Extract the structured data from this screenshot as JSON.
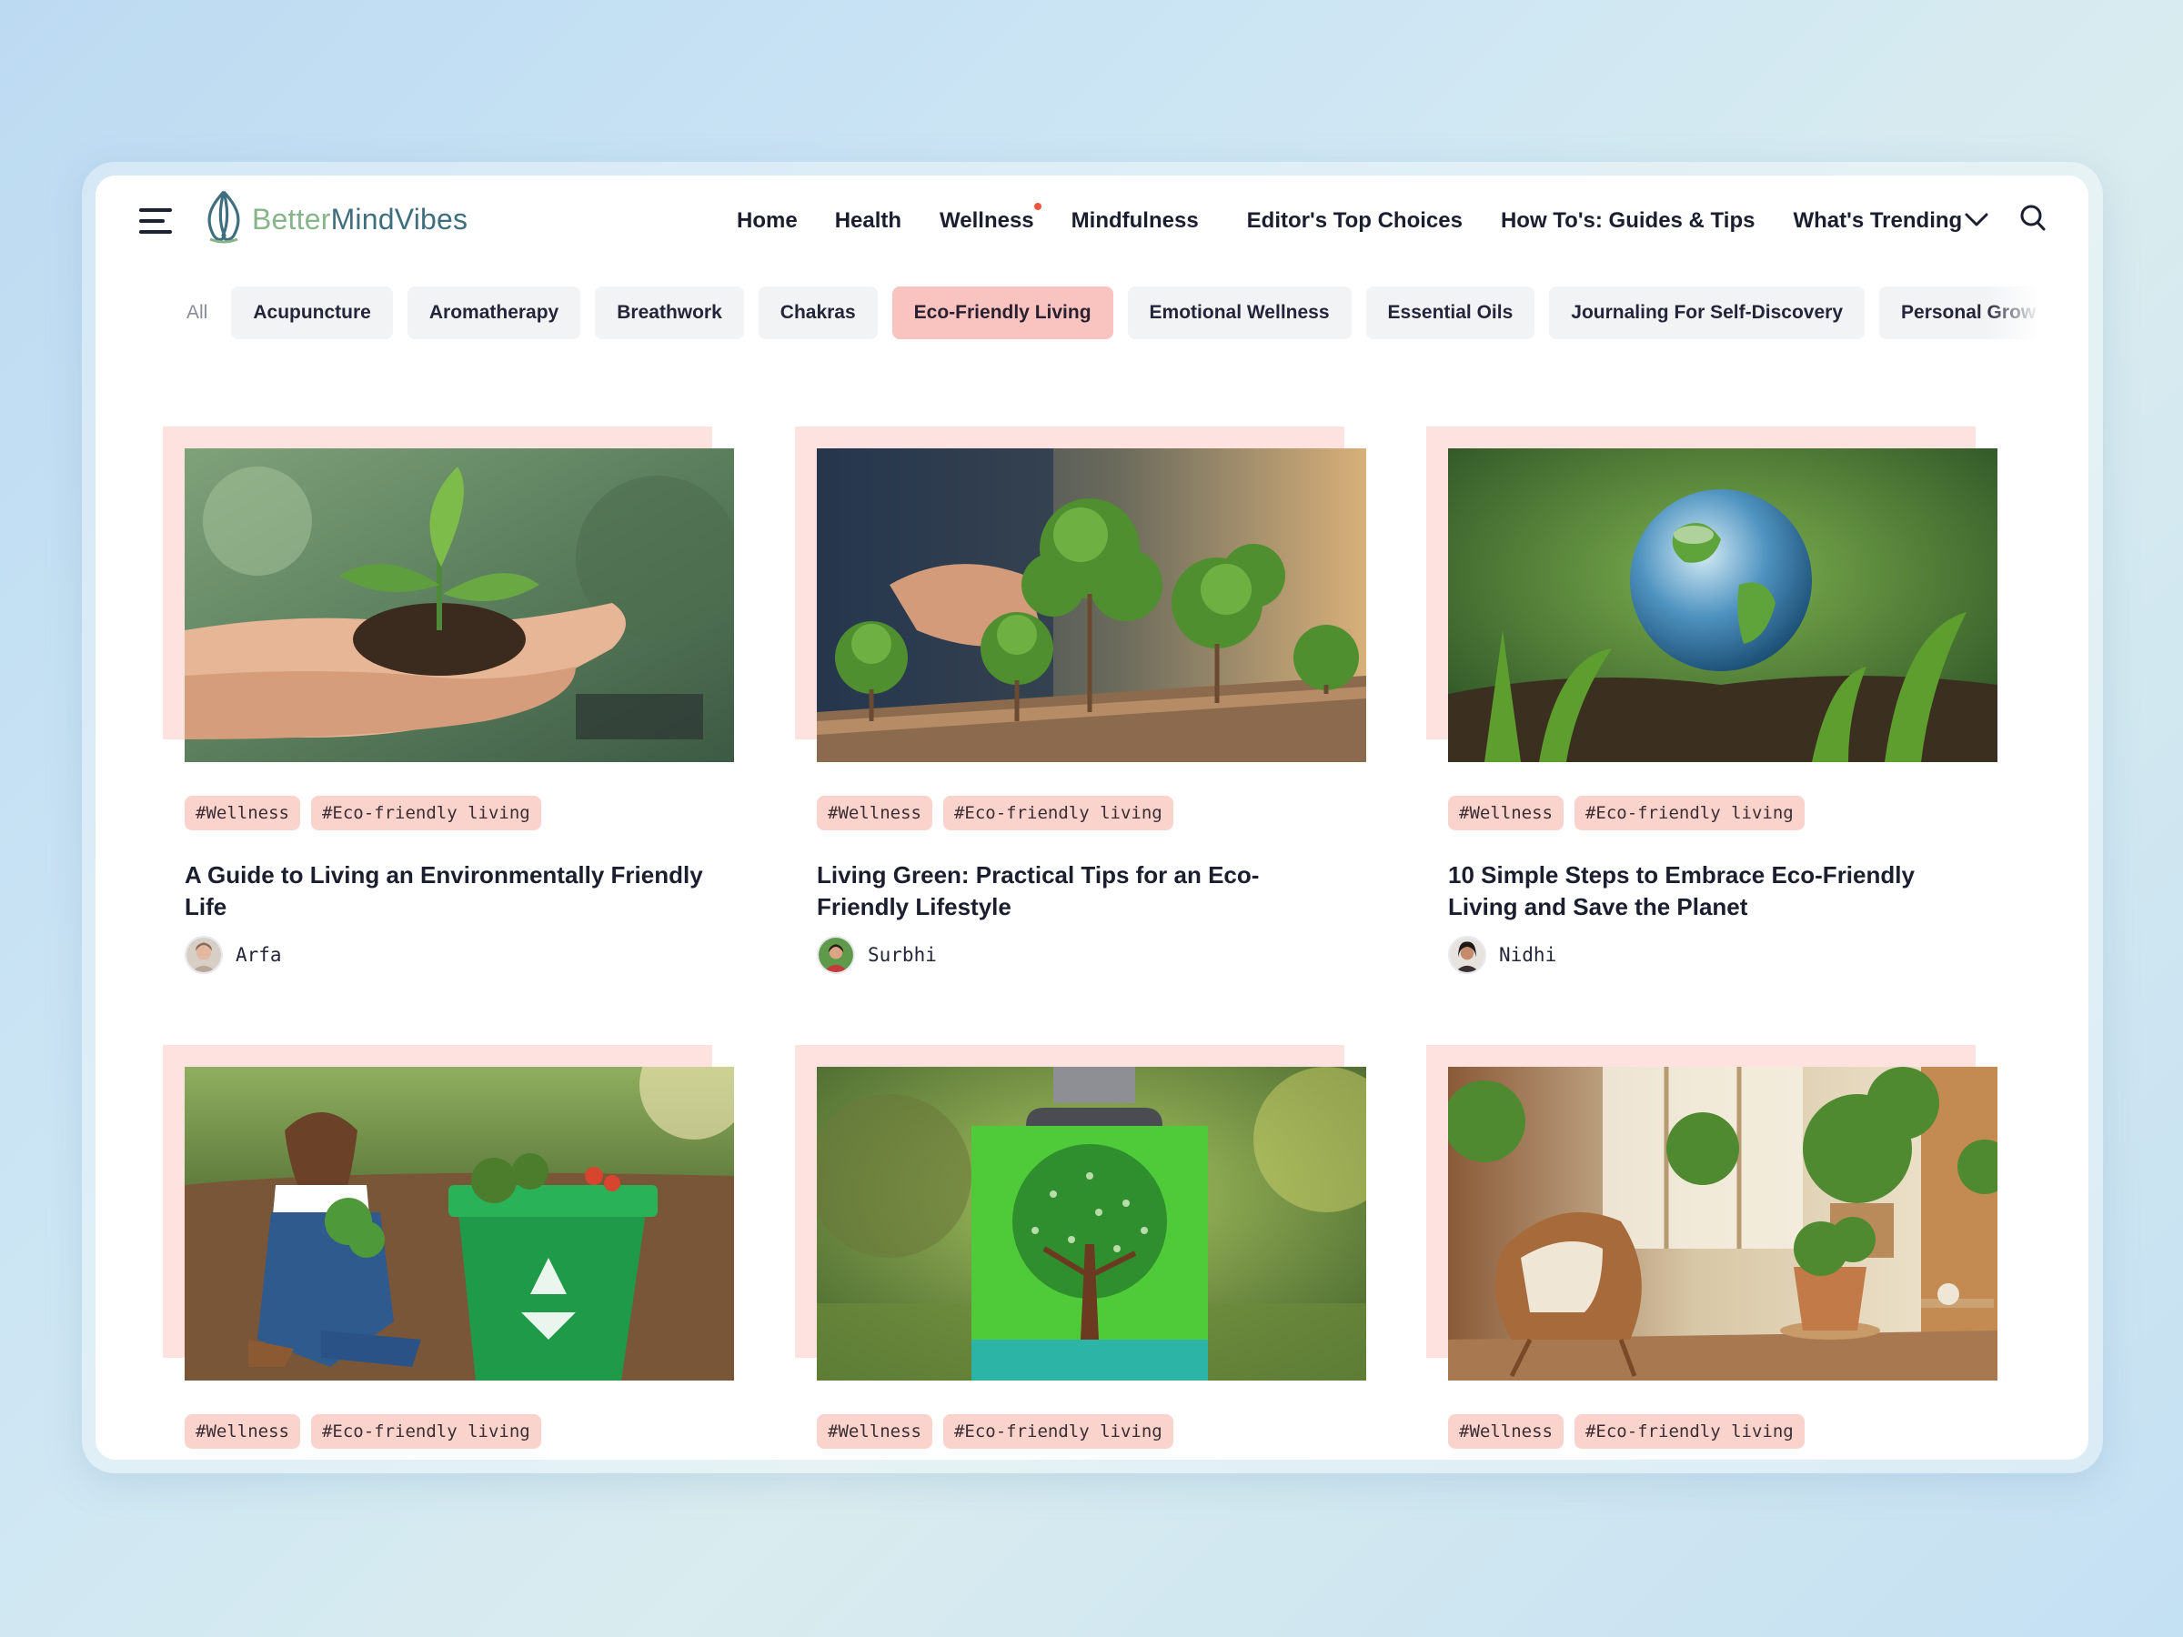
{
  "brand": {
    "name_part1": "Better",
    "name_part2": "MindVibes"
  },
  "nav": {
    "items": [
      {
        "label": "Home"
      },
      {
        "label": "Health"
      },
      {
        "label": "Wellness"
      },
      {
        "label": "Mindfulness"
      },
      {
        "label": "Editor's Top Choices"
      },
      {
        "label": "How To's: Guides & Tips"
      },
      {
        "label": "What's Trending"
      }
    ],
    "more_icon": "chevron-down-icon",
    "search_icon": "search-icon",
    "notification_dot_color": "#f0573a"
  },
  "categories": {
    "items": [
      "All",
      "Acupuncture",
      "Aromatherapy",
      "Breathwork",
      "Chakras",
      "Eco-Friendly Living",
      "Emotional Wellness",
      "Essential Oils",
      "Journaling For Self-Discovery",
      "Personal Grow"
    ],
    "active": "Eco-Friendly Living",
    "active_color": "#f9c4c0"
  },
  "articles": [
    {
      "tags": [
        "#Wellness",
        "#Eco-friendly living"
      ],
      "title": "A Guide to Living an Environmentally Friendly Life",
      "author": "Arfa",
      "image": "hands holding seedling in soil"
    },
    {
      "tags": [
        "#Wellness",
        "#Eco-friendly living"
      ],
      "title": "Living Green: Practical Tips for an Eco-Friendly Lifestyle",
      "author": "Surbhi",
      "image": "hand arranging miniature trees"
    },
    {
      "tags": [
        "#Wellness",
        "#Eco-friendly living"
      ],
      "title": "10 Simple Steps to Embrace Eco-Friendly Living and Save the Planet",
      "author": "Nidhi",
      "image": "glass globe among ferns"
    },
    {
      "tags": [
        "#Wellness",
        "#Eco-friendly living"
      ],
      "title": "",
      "author": "",
      "image": "woman gardening beside recycling bin"
    },
    {
      "tags": [
        "#Wellness",
        "#Eco-friendly living"
      ],
      "title": "",
      "author": "",
      "image": "green flask with tree print"
    },
    {
      "tags": [
        "#Wellness",
        "#Eco-friendly living"
      ],
      "title": "",
      "author": "",
      "image": "sunlit room with rattan chair and plants"
    }
  ],
  "colors": {
    "tag_bg": "#fbd3cd",
    "card_accent": "#fde2df"
  }
}
